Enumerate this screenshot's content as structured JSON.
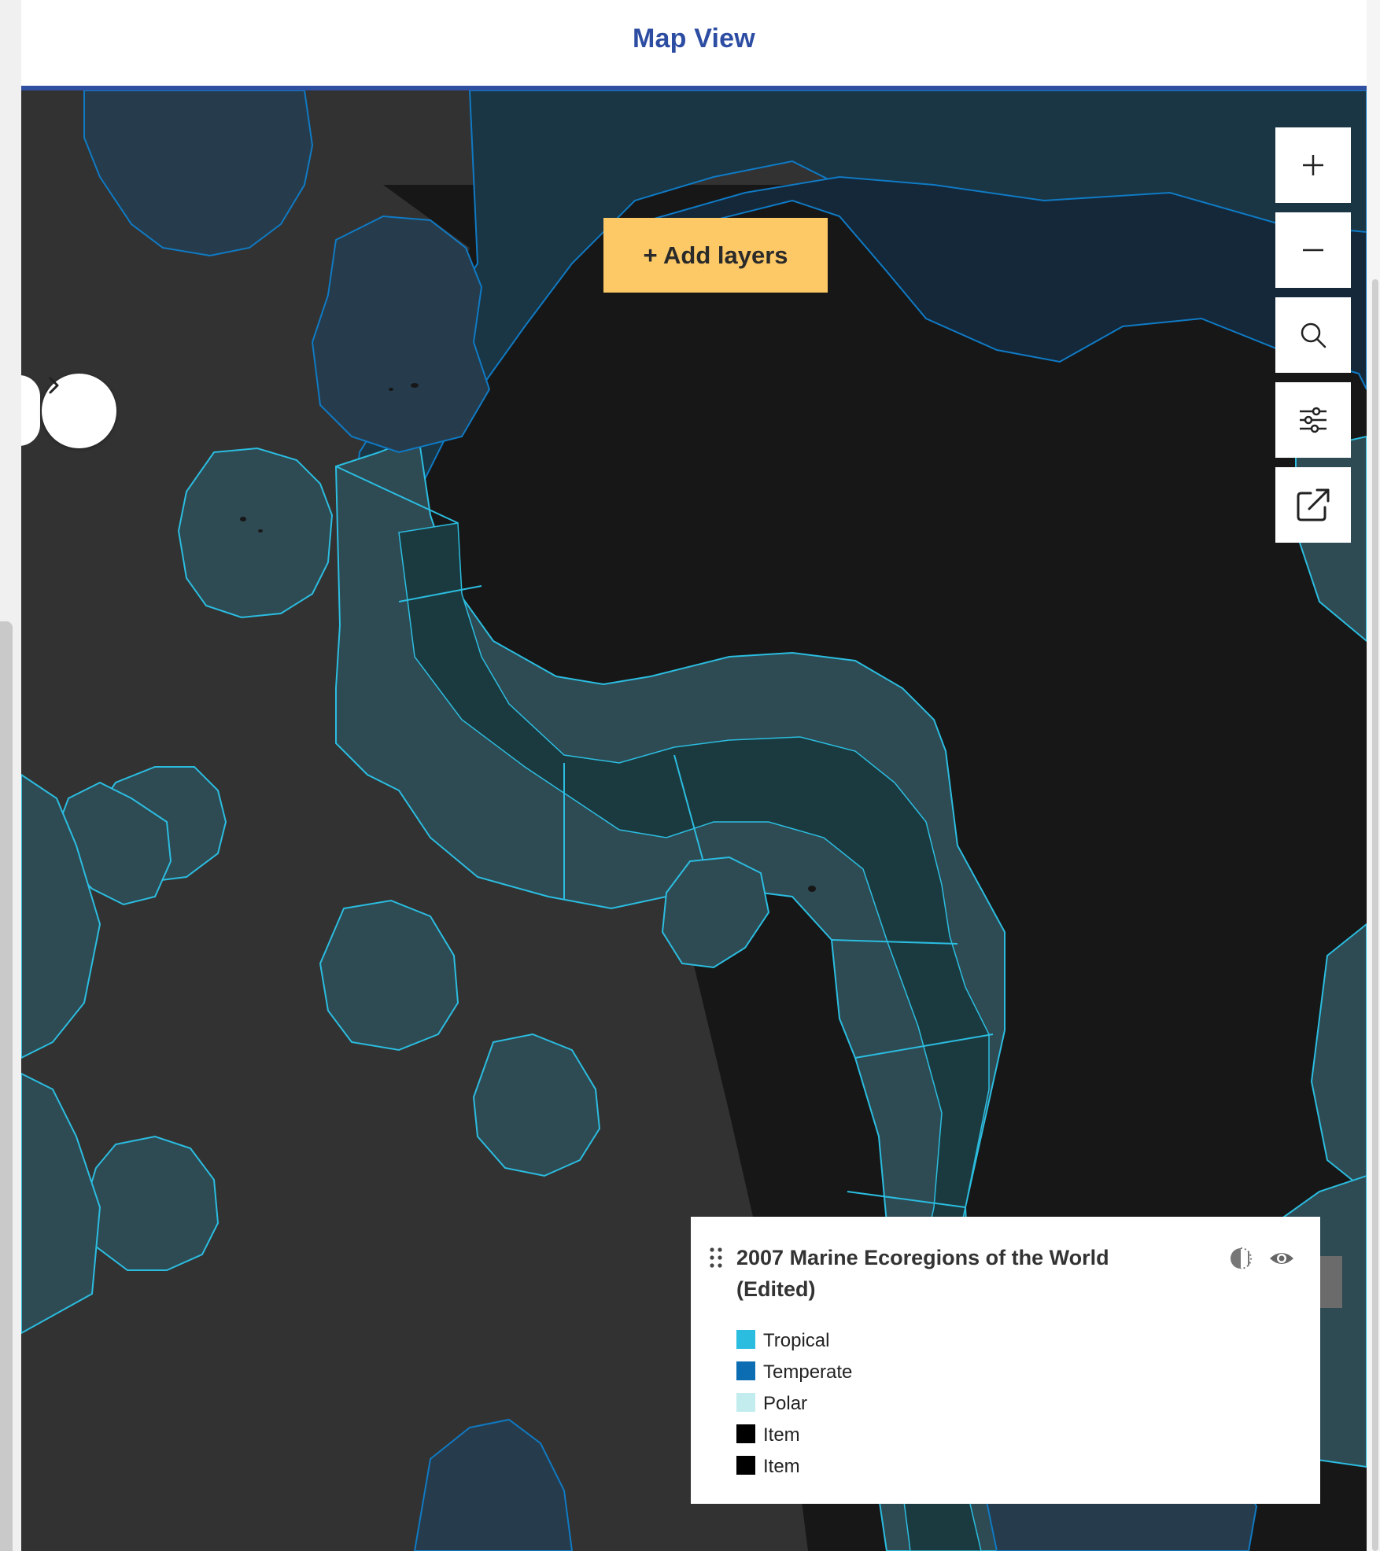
{
  "header": {
    "title": "Map View"
  },
  "toolbar": {
    "add_layers_label": "+ Add layers"
  },
  "map_controls": [
    {
      "name": "zoom-in-button",
      "icon": "plus-icon"
    },
    {
      "name": "zoom-out-button",
      "icon": "minus-icon"
    },
    {
      "name": "search-button",
      "icon": "search-icon"
    },
    {
      "name": "filter-button",
      "icon": "sliders-icon"
    },
    {
      "name": "share-button",
      "icon": "external-link-icon"
    }
  ],
  "sidebar_toggle": {
    "icon": "chevron-right-icon"
  },
  "legend_toggle": {
    "icon": "arrow-down-icon"
  },
  "legend": {
    "layer_title": "2007 Marine Ecoregions of the World (Edited)",
    "opacity_icon": "half-circle-icon",
    "visibility_icon": "eye-icon",
    "items": [
      {
        "label": "Tropical",
        "color": "#2bbde0"
      },
      {
        "label": "Temperate",
        "color": "#0c6db3"
      },
      {
        "label": "Polar",
        "color": "#c2ecee"
      },
      {
        "label": "Item",
        "color": "#000000"
      },
      {
        "label": "Item",
        "color": "#000000"
      }
    ]
  },
  "colors": {
    "header_accent": "#2f4fa0",
    "add_layers_bg": "#fdc966",
    "ocean": "#323232",
    "land": "#171717"
  }
}
